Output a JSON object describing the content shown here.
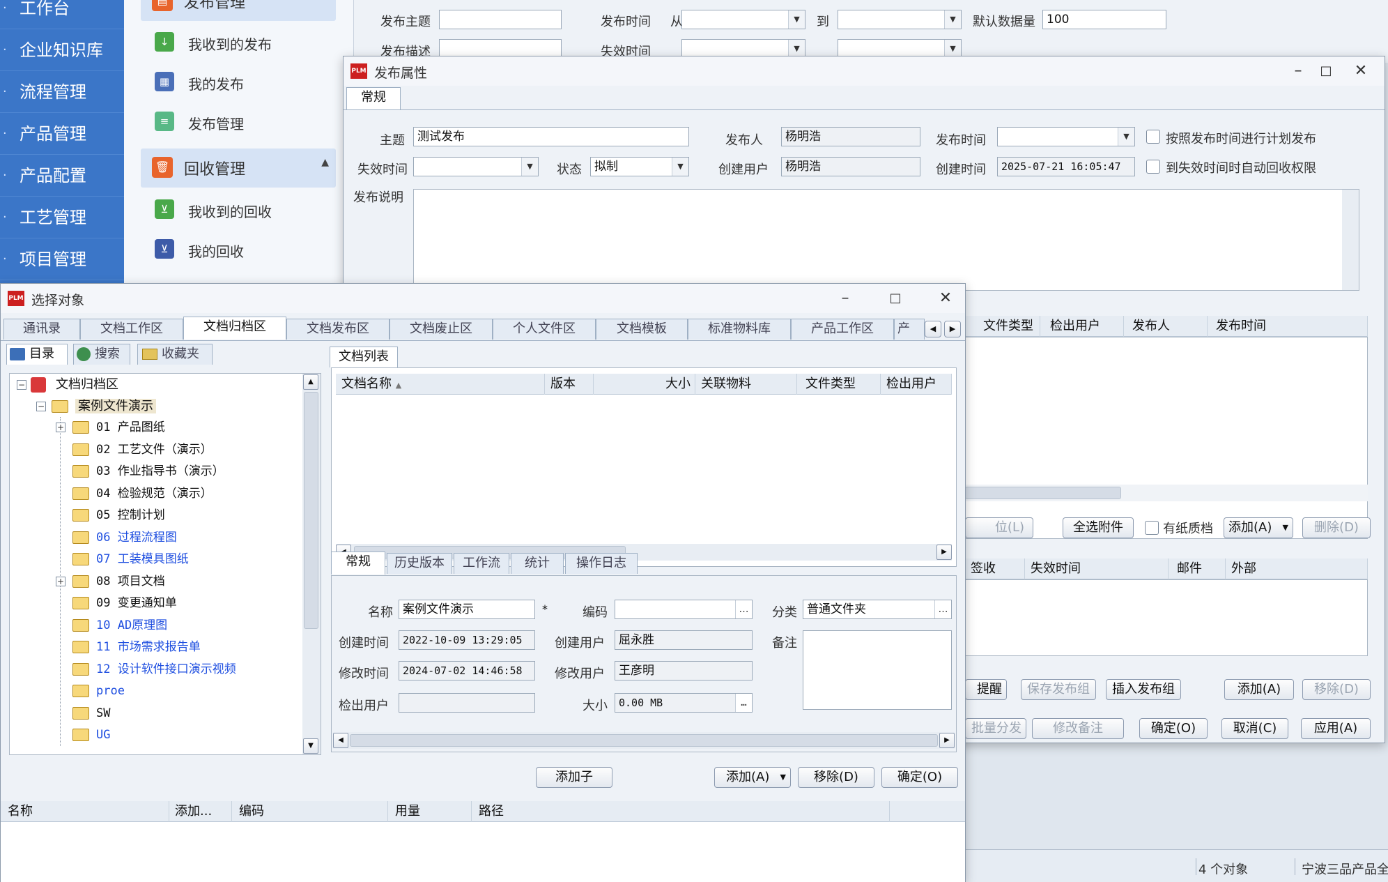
{
  "left_nav": {
    "items": [
      "工作台",
      "企业知识库",
      "流程管理",
      "产品管理",
      "产品配置",
      "工艺管理",
      "项目管理"
    ]
  },
  "sub_nav": {
    "group1": "发布管理",
    "group1_items": [
      "我收到的发布",
      "我的发布",
      "发布管理"
    ],
    "group2": "回收管理",
    "group2_items": [
      "我收到的回收",
      "我的回收"
    ]
  },
  "bg_search": {
    "subject_label": "发布主题",
    "desc_label": "发布描述",
    "time_label": "发布时间",
    "expire_label": "失效时间",
    "from": "从",
    "to": "到",
    "count_label": "默认数据量",
    "count_value": "100"
  },
  "release_window": {
    "title": "发布属性",
    "tab": "常规",
    "subject_label": "主题",
    "subject_value": "测试发布",
    "publisher_label": "发布人",
    "publisher_value": "杨明浩",
    "time_label": "发布时间",
    "schedule_check": "按照发布时间进行计划发布",
    "expire_label": "失效时间",
    "state_label": "状态",
    "state_value": "拟制",
    "creator_label": "创建用户",
    "creator_value": "杨明浩",
    "created_label": "创建时间",
    "created_value": "2025-07-21 16:05:47",
    "auto_recycle_check": "到失效时间时自动回收权限",
    "desc_label": "发布说明",
    "grid_cols": [
      "文件类型",
      "检出用户",
      "发布人",
      "发布时间"
    ],
    "locate_btn": "位(L)",
    "select_all_btn": "全选附件",
    "paper_check": "有纸质档",
    "add_btn": "添加(A)",
    "delete_btn": "删除(D)",
    "grid2_cols": [
      "签收",
      "失效时间",
      "邮件",
      "外部"
    ],
    "remind_btn": "提醒",
    "save_group_btn": "保存发布组",
    "insert_group_btn": "插入发布组",
    "add2_btn": "添加(A)",
    "remove2_btn": "移除(D)",
    "batch_btn": "批量分发",
    "edit_note_btn": "修改备注",
    "ok_btn": "确定(O)",
    "cancel_btn": "取消(C)",
    "apply_btn": "应用(A)"
  },
  "status_bar": {
    "count": "4 个对象",
    "company": "宁波三品产品全"
  },
  "select_window": {
    "title": "选择对象",
    "tabs": [
      "通讯录",
      "文档工作区",
      "文档归档区",
      "文档发布区",
      "文档废止区",
      "个人文件区",
      "文档模板",
      "标准物料库",
      "产品工作区",
      "产"
    ],
    "left_tabs": [
      "目录",
      "搜索",
      "收藏夹"
    ],
    "tree_root": "文档归档区",
    "tree_case": "案例文件演示",
    "tree_items": [
      {
        "label": "01 产品图纸",
        "blue": false,
        "exp": true
      },
      {
        "label": "02 工艺文件（演示）",
        "blue": false,
        "exp": false
      },
      {
        "label": "03 作业指导书（演示）",
        "blue": false,
        "exp": false
      },
      {
        "label": "04 检验规范（演示）",
        "blue": false,
        "exp": false
      },
      {
        "label": "05 控制计划",
        "blue": false,
        "exp": false
      },
      {
        "label": "06 过程流程图",
        "blue": true,
        "exp": false
      },
      {
        "label": "07 工装模具图纸",
        "blue": true,
        "exp": false
      },
      {
        "label": "08 项目文档",
        "blue": false,
        "exp": true
      },
      {
        "label": "09 变更通知单",
        "blue": false,
        "exp": false
      },
      {
        "label": "10 AD原理图",
        "blue": true,
        "exp": false
      },
      {
        "label": "11 市场需求报告单",
        "blue": true,
        "exp": false
      },
      {
        "label": "12 设计软件接口演示视频",
        "blue": true,
        "exp": false
      },
      {
        "label": "proe",
        "blue": true,
        "exp": false
      },
      {
        "label": "SW",
        "blue": false,
        "exp": false
      },
      {
        "label": "UG",
        "blue": true,
        "exp": false
      }
    ],
    "doc_list_tab": "文档列表",
    "doc_cols": [
      "文档名称",
      "版本",
      "大小",
      "关联物料",
      "文件类型",
      "检出用户"
    ],
    "detail_tabs": [
      "常规",
      "历史版本",
      "工作流",
      "统计",
      "操作日志"
    ],
    "name_label": "名称",
    "name_value": "案例文件演示",
    "code_label": "编码",
    "code_value": "",
    "category_label": "分类",
    "category_value": "普通文件夹",
    "created_label": "创建时间",
    "created_value": "2022-10-09 13:29:05",
    "creator_label": "创建用户",
    "creator_value": "屈永胜",
    "note_label": "备注",
    "modified_label": "修改时间",
    "modified_value": "2024-07-02 14:46:58",
    "modifier_label": "修改用户",
    "modifier_value": "王彦明",
    "checkout_label": "检出用户",
    "size_label": "大小",
    "size_value": "0.00 MB",
    "add_child_btn": "添加子",
    "add_btn": "添加(A)",
    "remove_btn": "移除(D)",
    "ok_btn": "确定(O)",
    "bottom_cols": [
      "名称",
      "添加...",
      "编码",
      "用量",
      "路径"
    ]
  }
}
